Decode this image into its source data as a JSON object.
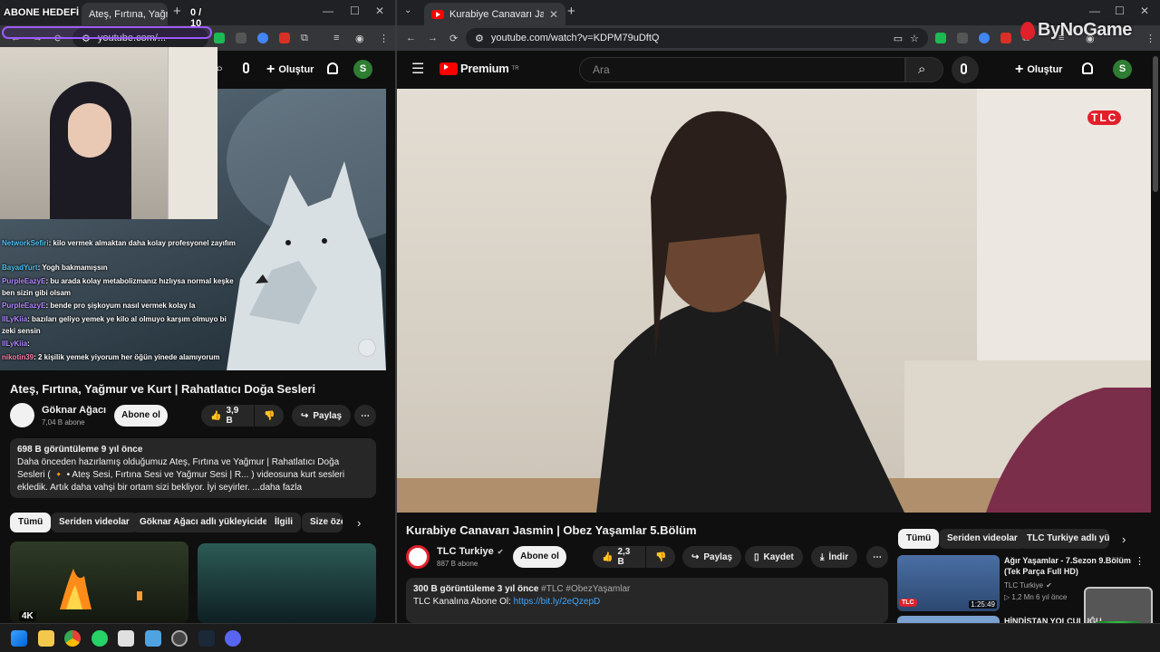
{
  "overlay": {
    "goal_label": "ABONE HEDEFİ",
    "goal_count": "0 / 10",
    "brand": "ByNoGame"
  },
  "left": {
    "tab_title": "Ateş, Fırtına, Yağmur ve Kurt | R...",
    "address": "youtube.com/...",
    "create_label": "Oluştur",
    "avatar_letter": "S",
    "chat": [
      {
        "user": "NetworkSefiri",
        "text": ": kilo vermek almaktan daha kolay profesyonel zayıfım",
        "color": "#3fa9f5"
      },
      {
        "user": "BayadYurt",
        "text": ": Yogh bakmamışsın",
        "color": "#3fa9f5"
      },
      {
        "user": "PurpleEazyE",
        "text": ": bu arada kolay metabolizmanız hızlıysa normal keşke ben sizin gibi olsam",
        "color": "#9b6bff"
      },
      {
        "user": "PurpleEazyE",
        "text": ": bende pro şişkoyum nasıl vermek kolay la",
        "color": "#9b6bff"
      },
      {
        "user": "lILyKiia",
        "text": ": bazıları geliyo yemek ye kilo al olmuyo karşım olmuyo bi zeki sensin",
        "color": "#b46bff"
      },
      {
        "user": "lILyKiia",
        "text": ":",
        "color": "#b46bff"
      },
      {
        "user": "nikotin39",
        "text": ": 2 kişilik yemek yiyorum her öğün yinede alamıyorum",
        "color": "#ff6b9a"
      }
    ],
    "video_title": "Ateş, Fırtına, Yağmur ve Kurt | Rahatlatıcı Doğa Sesleri",
    "channel_name": "Göknar Ağacı",
    "subscribers": "7,04 B abone",
    "subscribe_label": "Abone ol",
    "likes": "3,9 B",
    "share_label": "Paylaş",
    "views_line": "698 B görüntüleme  9 yıl önce",
    "description": "Daha önceden hazırlamış olduğumuz Ateş, Fırtına ve Yağmur | Rahatlatıcı Doğa Sesleri ( 🔸 • Ateş Sesi, Fırtına Sesi ve Yağmur Sesi | R... ) videosuna kurt sesleri ekledik. Artık daha vahşi bir ortam sizi bekliyor. İyi seyirler. ...daha fazla",
    "chips": [
      "Tümü",
      "Seriden videolar",
      "Göknar Ağacı adlı yükleyiciden",
      "İlgili",
      "Size özel"
    ],
    "thumb_badge": "4K"
  },
  "right": {
    "tab_title": "Kurabiye Canavarı Jasmin | Obe...",
    "address": "youtube.com/watch?v=KDPM79uDftQ",
    "logo_text": "Premium",
    "logo_sup": "TR",
    "search_placeholder": "Ara",
    "create_label": "Oluştur",
    "avatar_letter": "S",
    "tlc_logo": "TLC",
    "video_title": "Kurabiye Canavarı Jasmin | Obez Yaşamlar 5.Bölüm",
    "channel_name": "TLC Turkiye",
    "subscribers": "887 B abone",
    "subscribe_label": "Abone ol",
    "likes": "2,3 B",
    "share_label": "Paylaş",
    "save_label": "Kaydet",
    "download_label": "İndir",
    "views_line": "300 B görüntüleme  3 yıl önce",
    "tags": "#TLC #ObezYaşamlar",
    "desc_line": "TLC Kanalına Abone Ol: ",
    "desc_link": "https://bit.ly/2eQzepD",
    "chips": [
      "Tümü",
      "Seriden videolar",
      "TLC Turkiye adlı yükle"
    ],
    "rec": {
      "title": "Ağır Yaşamlar - 7.Sezon 9.Bölüm (Tek Parça Full HD)",
      "channel": "TLC Turkiye",
      "meta": "1,2 Mn  6 yıl önce",
      "duration": "1:25:49",
      "badge": "TLC"
    },
    "rec2_title": "HİNDİSTAN YOLCULUĞU"
  }
}
